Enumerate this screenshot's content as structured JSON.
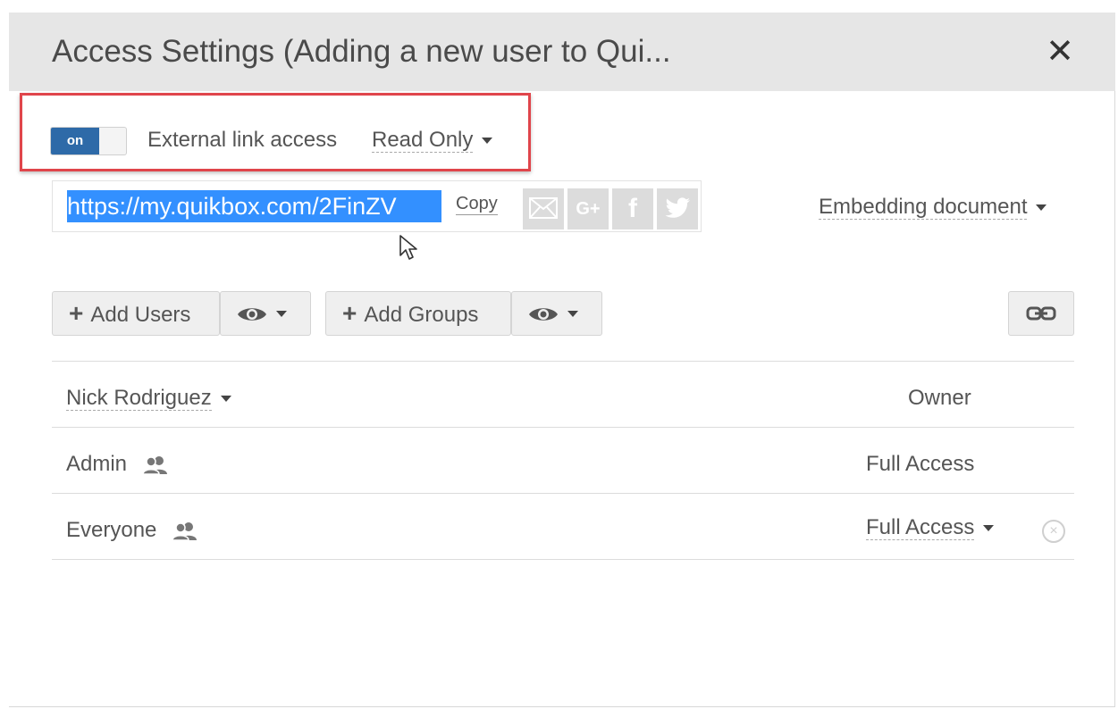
{
  "dialog": {
    "title": "Access Settings (Adding a new user to Qui...",
    "close_glyph": "✕",
    "close_icon": "close-icon"
  },
  "external_link": {
    "toggle_state": "on",
    "label": "External link access",
    "permission": "Read Only",
    "highlight_color": "#e0454b"
  },
  "share_link": {
    "url": "https://my.quikbox.com/2FinZV",
    "copy_label": "Copy",
    "share_icons": [
      "email-icon",
      "google-plus-icon",
      "facebook-icon",
      "twitter-icon"
    ],
    "google_plus_text": "G+",
    "facebook_text": "f",
    "selection_color": "#3390ff"
  },
  "embedding": {
    "label": "Embedding document"
  },
  "toolbar": {
    "add_users_label": "Add Users",
    "add_groups_label": "Add Groups",
    "plus_glyph": "+",
    "link_button_icon": "link-icon"
  },
  "members": [
    {
      "name": "Nick Rodriguez",
      "role": "Owner",
      "has_dropdown": true,
      "is_group": false
    },
    {
      "name": "Admin",
      "role": "Full Access",
      "has_dropdown": false,
      "is_group": true
    },
    {
      "name": "Everyone",
      "role": "Full Access",
      "has_dropdown": true,
      "is_group": true,
      "removable": true
    }
  ],
  "remove_glyph": "×",
  "colors": {
    "header_bg": "#e6e6e6",
    "toggle_on": "#2e6aa8",
    "button_bg": "#efefef"
  }
}
